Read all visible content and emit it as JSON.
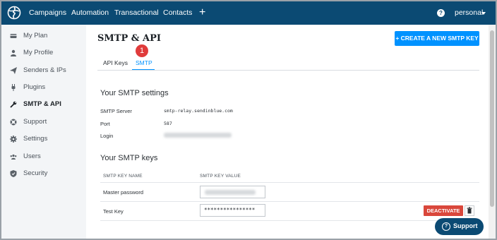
{
  "topbar": {
    "nav_items": [
      "Campaigns",
      "Automation",
      "Transactional",
      "Contacts"
    ],
    "plus": "+",
    "help": "?",
    "account": "personal"
  },
  "sidebar": {
    "items": [
      {
        "label": "My Plan",
        "icon": "card-icon"
      },
      {
        "label": "My Profile",
        "icon": "user-icon"
      },
      {
        "label": "Senders & IPs",
        "icon": "paper-plane-icon"
      },
      {
        "label": "Plugins",
        "icon": "plug-icon"
      },
      {
        "label": "SMTP & API",
        "icon": "wrench-icon",
        "active": true
      },
      {
        "label": "Support",
        "icon": "lifebuoy-icon"
      },
      {
        "label": "Settings",
        "icon": "gear-icon"
      },
      {
        "label": "Users",
        "icon": "users-icon"
      },
      {
        "label": "Security",
        "icon": "shield-icon"
      }
    ]
  },
  "main": {
    "title": "SMTP & API",
    "create_button": "+ CREATE A NEW SMTP KEY",
    "tabs": [
      {
        "label": "API Keys"
      },
      {
        "label": "SMTP",
        "active": true
      }
    ],
    "step_badge": "1",
    "settings": {
      "title": "Your SMTP settings",
      "rows": [
        {
          "label": "SMTP Server",
          "value": "smtp-relay.sendinblue.com"
        },
        {
          "label": "Port",
          "value": "587"
        },
        {
          "label": "Login",
          "value": ""
        }
      ]
    },
    "keys": {
      "title": "Your SMTP keys",
      "headers": [
        "SMTP KEY NAME",
        "SMTP KEY VALUE"
      ],
      "rows": [
        {
          "name": "Master password",
          "value": ""
        },
        {
          "name": "Test Key",
          "value": "****************"
        }
      ],
      "deactivate_label": "DEACTIVATE"
    }
  },
  "support_button": {
    "label": "Support",
    "icon": "?"
  },
  "colors": {
    "topbar": "#0b4a73",
    "accent": "#0092ff",
    "danger": "#d9473b",
    "badge": "#e03b3b"
  }
}
